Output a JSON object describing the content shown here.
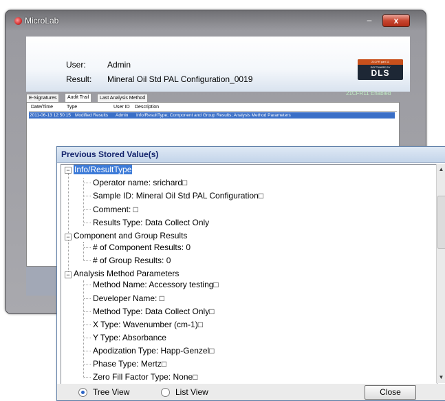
{
  "window": {
    "title": "MicroLab",
    "minimize_glyph": "–",
    "close_glyph": "x",
    "user_label": "User:",
    "user_value": "Admin",
    "result_label": "Result:",
    "result_value": "Mineral Oil Std PAL Configuration_0019",
    "logo": {
      "top_text": "21CFR part 11",
      "sub_text": "SOFTWARE BY",
      "main_text": "DLS"
    },
    "cfr_status": "21CFR11 Enabled",
    "tabs": [
      "E-Signatures",
      "Audit Trail",
      "Last Analysis Method"
    ],
    "active_tab": "Audit Trail",
    "audit_table": {
      "columns": [
        "Date/Time",
        "Type",
        "User ID",
        "Description"
      ],
      "rows": [
        {
          "datetime": "2011-06-13 12:50:15",
          "type": "Modified Results",
          "user": "Admin",
          "description": "Info/ResultType; Component and Group Results; Analysis Method Parameters"
        }
      ]
    }
  },
  "dialog": {
    "title": "Previous Stored Value(s)",
    "tree": {
      "group1": {
        "label": "Info/ResultType",
        "operator": "Operator name:   srichard□",
        "sample": "Sample ID:   Mineral Oil Std PAL Configuration□",
        "comment": "Comment:   □",
        "results_type": "Results Type:   Data Collect Only"
      },
      "group2": {
        "label": "Component and Group Results",
        "component_results": "# of Component Results:   0",
        "group_results": "# of Group Results:   0"
      },
      "group3": {
        "label": "Analysis Method Parameters",
        "method_name": "Method Name:   Accessory testing□",
        "developer": "Developer Name:   □",
        "method_type": "Method Type:   Data Collect Only□",
        "x_type": "X Type:   Wavenumber (cm-1)□",
        "y_type": "Y Type:   Absorbance",
        "apodization": "Apodization Type:   Happ-Genzel□",
        "phase": "Phase Type:   Mertz□",
        "zero_fill": "Zero Fill Factor Type:   None□"
      }
    },
    "view_options": [
      "Tree View",
      "List View"
    ],
    "selected_view": "Tree View",
    "close_label": "Close"
  },
  "colors": {
    "selection": "#3a6fc7",
    "tree_highlight": "#3d7bd8",
    "dialog_title_text": "#13236b",
    "cfr_text": "#bfe9c2"
  }
}
